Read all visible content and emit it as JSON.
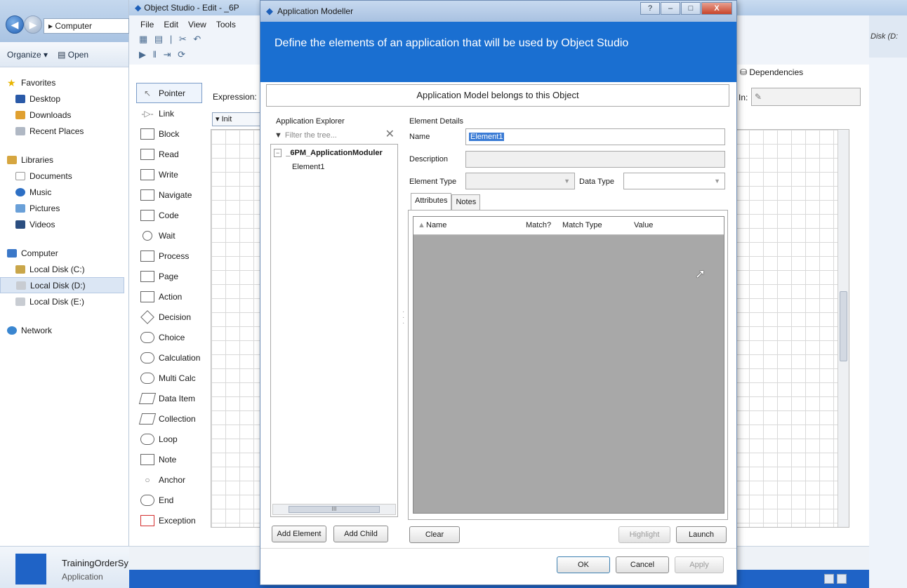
{
  "explorer": {
    "address": "Computer",
    "toolbar": {
      "organize": "Organize ▾",
      "open": "Open"
    },
    "nav": {
      "favorites": "Favorites",
      "desktop": "Desktop",
      "downloads": "Downloads",
      "recent_places": "Recent Places",
      "libraries": "Libraries",
      "documents": "Documents",
      "music": "Music",
      "pictures": "Pictures",
      "videos": "Videos",
      "computer": "Computer",
      "disk_c": "Local Disk (C:)",
      "disk_d": "Local Disk (D:)",
      "disk_e": "Local Disk (E:)",
      "network": "Network"
    },
    "details": {
      "name": "TrainingOrderSy",
      "type": "Application"
    },
    "right_edge_label": "Disk (D:"
  },
  "studio": {
    "title": "Object Studio - Edit - _6P",
    "menu": [
      "File",
      "Edit",
      "View",
      "Tools"
    ],
    "palette": [
      "Pointer",
      "Link",
      "Block",
      "Read",
      "Write",
      "Navigate",
      "Code",
      "Wait",
      "Process",
      "Page",
      "Action",
      "Decision",
      "Choice",
      "Calculation",
      "Multi Calc",
      "Data Item",
      "Collection",
      "Loop",
      "Note",
      "Anchor",
      "End",
      "Exception"
    ],
    "expression_label": "Expression:",
    "page_tab": "Init",
    "dependencies_tab": "Dependencies",
    "in_label": "In:"
  },
  "dialog": {
    "title": "Application Modeller",
    "window_controls": {
      "help": "?",
      "minimize": "–",
      "maximize": "□",
      "close": "X"
    },
    "header": "Define the elements of an application that will be used by Object Studio",
    "belongs_text": "Application Model belongs to this Object",
    "app_explorer": {
      "label": "Application Explorer",
      "filter_placeholder": "Filter the tree...",
      "root": "_6PM_ApplicationModuler",
      "child": "Element1",
      "scroll_mark": "III"
    },
    "element_details": {
      "label": "Element Details",
      "name_label": "Name",
      "name_value": "Element1",
      "description_label": "Description",
      "description_value": "",
      "element_type_label": "Element Type",
      "element_type_value": "",
      "data_type_label": "Data Type",
      "data_type_value": ""
    },
    "tabs": [
      "Attributes",
      "Notes"
    ],
    "grid_columns": {
      "name": "Name",
      "match": "Match?",
      "match_type": "Match Type",
      "value": "Value"
    },
    "buttons": {
      "add_element": "Add Element",
      "add_child": "Add Child",
      "clear": "Clear",
      "highlight": "Highlight",
      "launch": "Launch",
      "ok": "OK",
      "cancel": "Cancel",
      "apply": "Apply"
    }
  },
  "colors": {
    "header_blue": "#1a6fd1",
    "status_blue": "#1f63c6",
    "attr_grid_gray": "#a8a8a8"
  }
}
